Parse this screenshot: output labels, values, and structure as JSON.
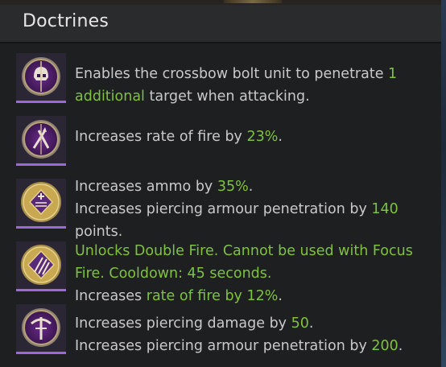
{
  "panel": {
    "title": "Doctrines"
  },
  "doctrines": [
    {
      "icon": "skull-emblem-icon",
      "lines": [
        {
          "a": "Enables the crossbow bolt unit to penetrate ",
          "g": "1",
          "b": ""
        },
        {
          "a": "",
          "g": "additional",
          "b": " target when attacking."
        }
      ]
    },
    {
      "icon": "crossed-bolts-emblem-icon",
      "lines": [
        {
          "a": "Increases rate of fire by ",
          "g": "23%",
          "b": "."
        }
      ]
    },
    {
      "icon": "ammo-plus-emblem-icon",
      "lines": [
        {
          "a": "Increases ammo by ",
          "g": "35%",
          "b": "."
        },
        {
          "a": "Increases piercing armour penetration by ",
          "g": "140",
          "b": ""
        },
        {
          "a": "points.",
          "g": "",
          "b": ""
        }
      ]
    },
    {
      "icon": "triple-bolt-emblem-icon",
      "lines": [
        {
          "a": "",
          "g": "Unlocks Double Fire. Cannot be used with Focus",
          "b": ""
        },
        {
          "a": "",
          "g": "Fire. Cooldown: 45 seconds.",
          "b": ""
        },
        {
          "a": "Increases ",
          "g": "rate of fire by 12%",
          "b": "."
        }
      ]
    },
    {
      "icon": "crossbow-emblem-icon",
      "lines": [
        {
          "a": "Increases piercing damage by ",
          "g": "50",
          "b": "."
        },
        {
          "a": "Increases piercing armour penetration by ",
          "g": "200",
          "b": "."
        }
      ]
    }
  ],
  "colors": {
    "highlight": "#7fc241",
    "text": "#c9c9c9",
    "title": "#e6e6e6",
    "icon_border": "#9a6ad8"
  }
}
